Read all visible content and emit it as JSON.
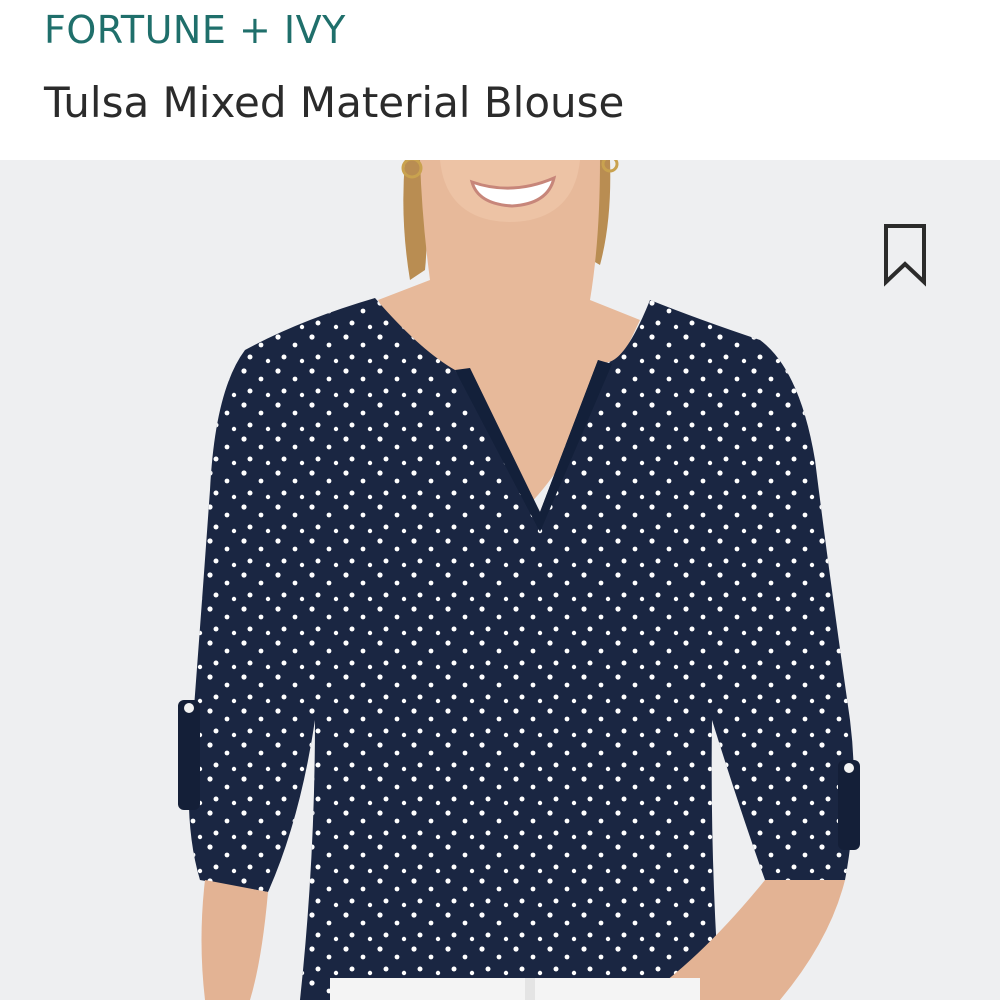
{
  "brand": "FORTUNE + IVY",
  "product": {
    "title": "Tulsa Mixed Material Blouse"
  },
  "photo": {
    "description_icon": "model-wearing-blouse",
    "background_color": "#eeeff1",
    "blouse_color": "#1a2642",
    "dot_color": "#ffffff",
    "skin_color": "#e7b99a"
  },
  "actions": {
    "save_icon": "bookmark-icon"
  },
  "colors": {
    "brand": "#1f6f6b",
    "title": "#2b2b2b"
  }
}
